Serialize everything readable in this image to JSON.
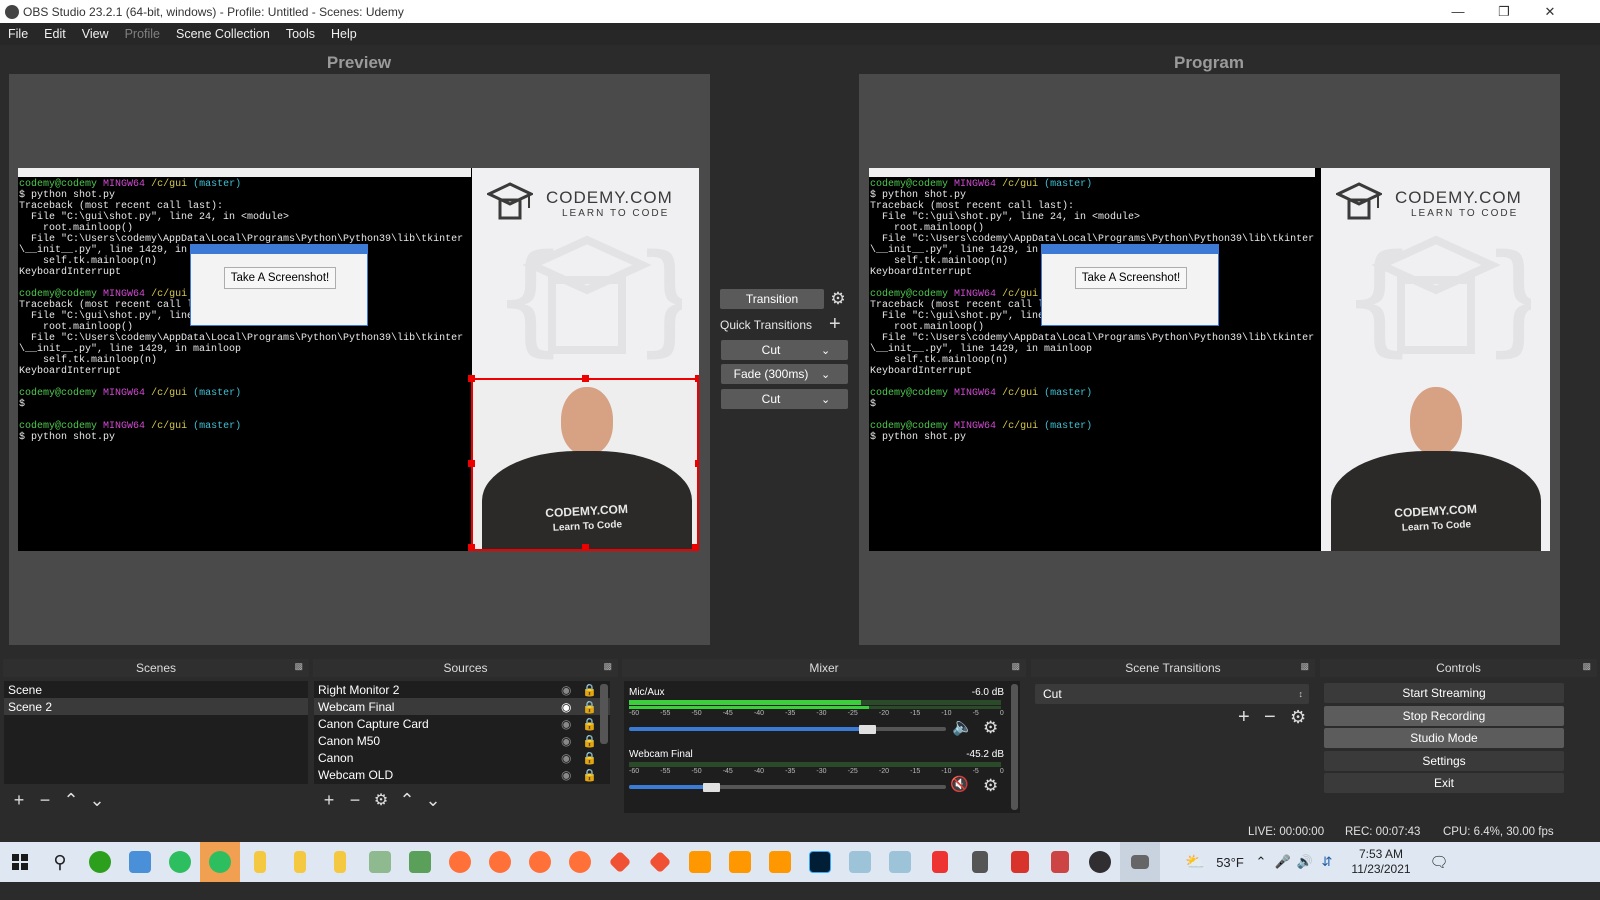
{
  "window": {
    "title": "OBS Studio 23.2.1 (64-bit, windows) - Profile: Untitled - Scenes: Udemy"
  },
  "menu": [
    "File",
    "Edit",
    "View",
    "Profile",
    "Scene Collection",
    "Tools",
    "Help"
  ],
  "preview": {
    "label": "Preview"
  },
  "program": {
    "label": "Program"
  },
  "terminal": {
    "lines": [
      "codemy@codemy MINGW64 /c/gui (master)",
      "$ python shot.py",
      "Traceback (most recent call last):",
      "  File \"C:\\gui\\shot.py\", line 24, in <module>",
      "    root.mainloop()",
      "  File \"C:\\Users\\codemy\\AppData\\Local\\Programs\\Python\\Python39\\lib\\tkinter",
      "\\__init__.py\", line 1429, in mainloop",
      "    self.tk.mainloop(n)",
      "KeyboardInterrupt",
      "",
      "codemy@codemy MINGW64 /c/gui (master)",
      "Traceback (most recent call last):",
      "  File \"C:\\gui\\shot.py\", line 24, in <module>",
      "    root.mainloop()",
      "  File \"C:\\Users\\codemy\\AppData\\Local\\Programs\\Python\\Python39\\lib\\tkinter",
      "\\__init__.py\", line 1429, in mainloop",
      "    self.tk.mainloop(n)",
      "KeyboardInterrupt",
      "",
      "codemy@codemy MINGW64 /c/gui (master)",
      "$",
      "",
      "codemy@codemy MINGW64 /c/gui (master)",
      "$ python shot.py"
    ]
  },
  "popup": {
    "button": "Take A Screenshot!"
  },
  "brand": {
    "name": "CODEMY.COM",
    "tagline": "LEARN TO CODE",
    "shirt_line1": "CODEMY.COM",
    "shirt_line2": "Learn To Code"
  },
  "transition_panel": {
    "transition_button": "Transition",
    "quick_transitions_label": "Quick Transitions",
    "items": [
      "Cut",
      "Fade (300ms)",
      "Cut"
    ]
  },
  "docks": {
    "scenes": {
      "title": "Scenes",
      "items": [
        "Scene",
        "Scene 2"
      ]
    },
    "sources": {
      "title": "Sources",
      "items": [
        "Right Monitor 2",
        "Webcam Final",
        "Canon Capture Card",
        "Canon M50",
        "Canon",
        "Webcam OLD"
      ]
    },
    "mixer": {
      "title": "Mixer",
      "channels": [
        {
          "name": "Mic/Aux",
          "level": "-6.0 dB",
          "volume": 0.75,
          "muted": false
        },
        {
          "name": "Webcam Final",
          "level": "-45.2 dB",
          "volume": 0.26,
          "muted": true
        }
      ],
      "scale": [
        "-60",
        "-55",
        "-50",
        "-45",
        "-40",
        "-35",
        "-30",
        "-25",
        "-20",
        "-15",
        "-10",
        "-5",
        "0"
      ]
    },
    "scene_transitions": {
      "title": "Scene Transitions",
      "selected": "Cut"
    },
    "controls": {
      "title": "Controls",
      "buttons": [
        "Start Streaming",
        "Stop Recording",
        "Studio Mode",
        "Settings",
        "Exit"
      ]
    }
  },
  "status": {
    "live": "LIVE: 00:00:00",
    "rec": "REC: 00:07:43",
    "cpu": "CPU: 6.4%, 30.00 fps"
  },
  "taskbar": {
    "temperature": "53°F",
    "time": "7:53 AM",
    "date": "11/23/2021"
  },
  "colors": {
    "accent_red": "#e00000",
    "meter_green": "#3ccf3c",
    "slider_blue": "#3a7bd5"
  }
}
